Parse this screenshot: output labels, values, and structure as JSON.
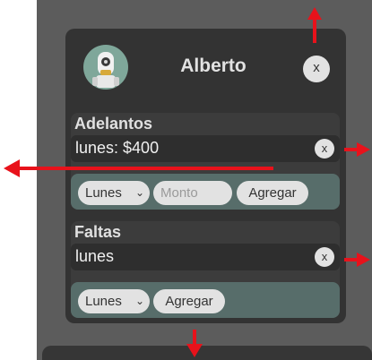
{
  "profile": {
    "name": "Alberto",
    "close_label": "x"
  },
  "adelantos": {
    "title": "Adelantos",
    "entry": "lunes: $400",
    "entry_close": "x",
    "day_select": "Lunes",
    "amount_placeholder": "Monto",
    "add_label": "Agregar"
  },
  "faltas": {
    "title": "Faltas",
    "entry": "lunes",
    "entry_close": "x",
    "day_select": "Lunes",
    "add_label": "Agregar"
  },
  "colors": {
    "arrow": "#e8121b",
    "card": "#333333",
    "form_row": "#576d6a"
  }
}
